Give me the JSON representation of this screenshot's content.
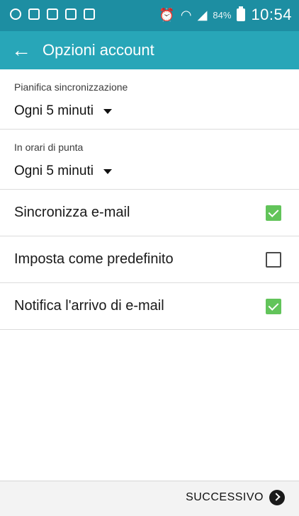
{
  "status_bar": {
    "left_icons": [
      "whatsapp-icon",
      "gallery-icon",
      "photo-icon",
      "message-icon",
      "calendar-icon"
    ],
    "alarm_icon": "alarm-icon",
    "wifi_icon": "wifi-icon",
    "signal_icon": "signal-icon",
    "battery_percent": "84%",
    "time": "10:54"
  },
  "app_bar": {
    "back_icon": "back-arrow-icon",
    "title": "Opzioni account",
    "color": "#28a6b8"
  },
  "settings": {
    "sync_schedule": {
      "label": "Pianifica sincronizzazione",
      "value": "Ogni 5 minuti"
    },
    "peak_hours": {
      "label": "In orari di punta",
      "value": "Ogni 5 minuti"
    },
    "options": [
      {
        "label": "Sincronizza e-mail",
        "checked": true
      },
      {
        "label": "Imposta come predefinito",
        "checked": false
      },
      {
        "label": "Notifica l'arrivo di e-mail",
        "checked": true
      }
    ]
  },
  "bottom_bar": {
    "next_label": "SUCCESSIVO",
    "next_icon": "chevron-right-circle-icon"
  },
  "colors": {
    "status_bar": "#1d8ea2",
    "checkbox_checked": "#62c45a"
  }
}
